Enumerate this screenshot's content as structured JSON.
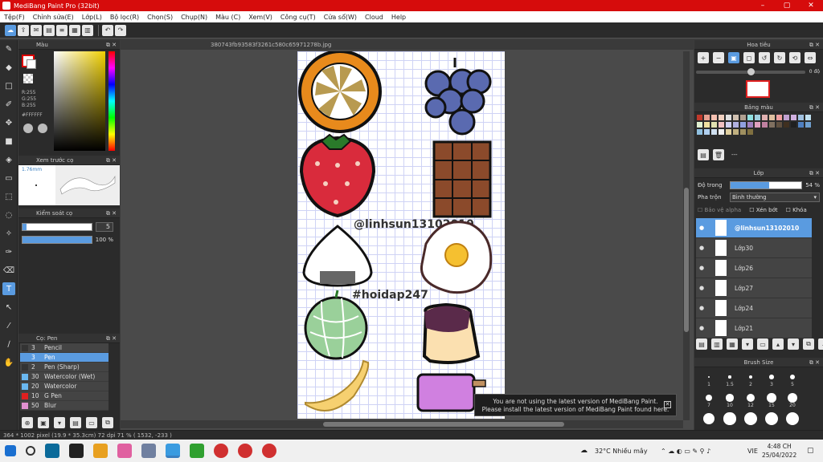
{
  "window": {
    "title": "MediBang Paint Pro (32bit)",
    "min": "–",
    "max": "▢",
    "close": "✕"
  },
  "menu": [
    "Tệp(F)",
    "Chỉnh sửa(E)",
    "Lớp(L)",
    "Bộ lọc(R)",
    "Chọn(S)",
    "Chụp(N)",
    "Màu (C)",
    "Xem(V)",
    "Công cụ(T)",
    "Cửa sổ(W)",
    "Cloud",
    "Help"
  ],
  "panels": {
    "color": {
      "title": "Màu",
      "r": "R:255",
      "g": "G:255",
      "b": "B:255",
      "hex": "#FFFFFF"
    },
    "brush_preview": {
      "title": "Xem trước cọ",
      "size": "1.76mm"
    },
    "brush_control": {
      "title": "Kiểm soát cọ",
      "size_value": "5",
      "opacity_value": "100 %"
    },
    "brush_list": {
      "title": "Cọ: Pen"
    }
  },
  "brushes": [
    {
      "size": "3",
      "name": "Pencil",
      "color": "#333333"
    },
    {
      "size": "3",
      "name": "Pen",
      "color": "#5a9be0"
    },
    {
      "size": "2",
      "name": "Pen (Sharp)",
      "color": "#333333"
    },
    {
      "size": "30",
      "name": "Watercolor (Wet)",
      "color": "#6ab8f0"
    },
    {
      "size": "20",
      "name": "Watercolor",
      "color": "#6ab8f0"
    },
    {
      "size": "10",
      "name": "G Pen",
      "color": "#e02020"
    },
    {
      "size": "50",
      "name": "Blur",
      "color": "#e090d0"
    }
  ],
  "document": {
    "filename": "380743fb93583f3261c580c65971278b.jpg"
  },
  "artwork": {
    "watermark1": "@linhsun13102010",
    "watermark2": "#hoidap247"
  },
  "notice": {
    "line1": "You are not using the latest version of MediBang Paint.",
    "line2": "Please install the latest version of MediBang Paint found here.",
    "close": "✕"
  },
  "navigator": {
    "title": "Hoa tiêu",
    "angle": "0 độ"
  },
  "palette": {
    "title": "Bảng màu",
    "label": "---",
    "colors": [
      "#c0392b",
      "#e8a090",
      "#f5c0b0",
      "#f0d0c0",
      "#e0e0e0",
      "#d0c0b0",
      "#b0a090",
      "#90e0e0",
      "#a0d0e0",
      "#e0b0b0",
      "#e0c0a0",
      "#f0a0a0",
      "#c0a0d0",
      "#d0b0e0",
      "#a0c0e0",
      "#c0e0f0",
      "#e0f0d0",
      "#f0e0a0",
      "#e0e0b0",
      "#f0c0c0",
      "#d0d0f0",
      "#b0b0e0",
      "#90a0e0",
      "#a080c0",
      "#e0a0c0",
      "#c080a0",
      "#807060",
      "#605040",
      "#403020",
      "#202020",
      "#5080c0",
      "#70a0d0",
      "#90c0e0",
      "#b0d0f0",
      "#d0e0f0",
      "#f0f0f0",
      "#e0d0a0",
      "#c0b080",
      "#a09060",
      "#807040"
    ]
  },
  "layers_panel": {
    "title": "Lớp",
    "opacity_label": "Độ trong",
    "opacity_value": "54 %",
    "blend_label": "Pha trộn",
    "blend_value": "Bình thường",
    "protect_alpha": "Bảo vệ alpha",
    "clip": "Xén bớt",
    "lock": "Khóa",
    "layers": [
      {
        "name": "@linhsun13102010",
        "selected": true
      },
      {
        "name": "Lớp30",
        "selected": false
      },
      {
        "name": "Lớp26",
        "selected": false
      },
      {
        "name": "Lớp27",
        "selected": false
      },
      {
        "name": "Lớp24",
        "selected": false
      },
      {
        "name": "Lớp21",
        "selected": false
      }
    ]
  },
  "brush_size": {
    "title": "Brush Size",
    "labels": [
      "1",
      "1.5",
      "2",
      "3",
      "5",
      "7",
      "10",
      "12",
      "15",
      "20"
    ]
  },
  "status": {
    "text": "364 * 1002 pixel  (19.9 * 35.3cm)  72 dpi  71 %  ( 1532, -233 )"
  },
  "taskbar": {
    "weather": "32°C  Nhiều mây",
    "lang": "VIE",
    "time": "4:48 CH",
    "date": "25/04/2022"
  }
}
